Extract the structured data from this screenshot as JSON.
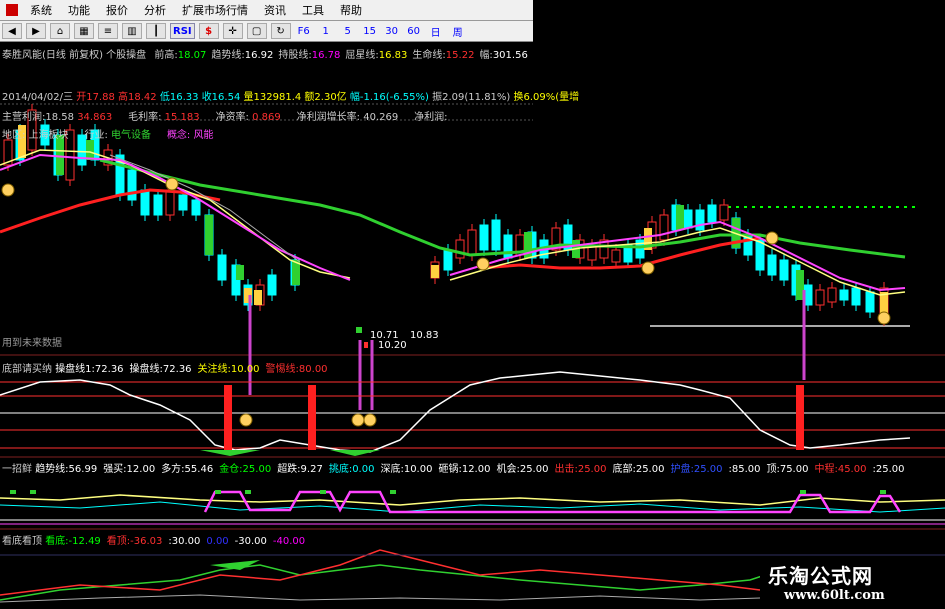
{
  "menu": [
    "系统",
    "功能",
    "报价",
    "分析",
    "扩展市场行情",
    "资讯",
    "工具",
    "帮助"
  ],
  "toolbar": [
    "F6",
    "1",
    "5",
    "15",
    "30",
    "60",
    "日",
    "周"
  ],
  "info_bar": {
    "title": "泰胜风能(日线 前复权) 个股操盘",
    "items": [
      {
        "label": "前高:",
        "value": "18.07",
        "color": "#00ff00"
      },
      {
        "label": "趋势线:",
        "value": "16.92",
        "color": "#ffffff"
      },
      {
        "label": "持股线:",
        "value": "16.78",
        "color": "#ff00ff"
      },
      {
        "label": "屈星线:",
        "value": "16.83",
        "color": "#ffff00"
      },
      {
        "label": "生命线:",
        "value": "15.22",
        "color": "#ff3030"
      },
      {
        "label": "幅:",
        "value": "301.56",
        "color": "#ffffff"
      }
    ]
  },
  "quote_bar": {
    "date": "2014/04/02/三",
    "open": "开17.88",
    "high": "高18.42",
    "low": "低16.33",
    "close": "收16.54",
    "vol": "量132981.4",
    "amt": "额2.30亿",
    "chg": "幅-1.16(-6.55%)",
    "amp": "振2.09(11.81%)",
    "turn": "换6.09%(量增"
  },
  "fund_bar": {
    "main": "主营利润:18.58",
    "main_v": "34.863",
    "profit": "毛利率:",
    "profit_v": "15.183",
    "net": "净资率:",
    "net_v": "0.869",
    "grow": "净利润增长率:",
    "grow_v": "40.269",
    "np": "净利润:"
  },
  "region_bar": {
    "region": "地区:",
    "region_v": "上海板块",
    "industry": "行业:",
    "industry_v": "电气设备",
    "concept": "概念:",
    "concept_v": "风能"
  },
  "future_label": "用到未来数据",
  "price_marks": {
    "a": "10.71",
    "b": "10.83",
    "c": "10.20"
  },
  "panel2": {
    "title": "底部请买纳",
    "items": [
      {
        "label": "操盘线1:",
        "value": "72.36",
        "color": "#ffffff"
      },
      {
        "label": "操盘线:",
        "value": "72.36",
        "color": "#ffffff"
      },
      {
        "label": "关注线:",
        "value": "10.00",
        "color": "#ffff00"
      },
      {
        "label": "警惕线:",
        "value": "80.00",
        "color": "#ff3030"
      },
      {
        "label": "",
        "value": "",
        "color": "#3030ff"
      }
    ]
  },
  "panel3": {
    "title": "一招鲜",
    "items": [
      {
        "label": "趋势线:",
        "value": "56.99",
        "color": "#ffffff"
      },
      {
        "label": "强买:",
        "value": "12.00",
        "color": "#ffffff"
      },
      {
        "label": "多方:",
        "value": "55.46",
        "color": "#ffffff"
      },
      {
        "label": "金仓:",
        "value": "25.00",
        "color": "#00ff00"
      },
      {
        "label": "超跌:",
        "value": "9.27",
        "color": "#ffffff"
      },
      {
        "label": "挑底:",
        "value": "0.00",
        "color": "#00ffff"
      },
      {
        "label": "深底:",
        "value": "10.00",
        "color": "#ffffff"
      },
      {
        "label": "砸锅:",
        "value": "12.00",
        "color": "#ffffff"
      },
      {
        "label": "机会:",
        "value": "25.00",
        "color": "#ffffff"
      },
      {
        "label": "出击:",
        "value": "25.00",
        "color": "#ff3030"
      },
      {
        "label": "底部:",
        "value": "25.00",
        "color": "#ffffff"
      },
      {
        "label": "护盘:",
        "value": "25.00",
        "color": "#3050ff"
      },
      {
        "label": ":",
        "value": "85.00",
        "color": "#ffffff"
      },
      {
        "label": "顶:",
        "value": "75.00",
        "color": "#ffffff"
      },
      {
        "label": "中程:",
        "value": "45.00",
        "color": "#ff3030"
      },
      {
        "label": ":",
        "value": "25.00",
        "color": "#ffffff"
      }
    ]
  },
  "panel4": {
    "title": "看底看顶",
    "items": [
      {
        "label": "看底:",
        "value": "-12.49",
        "color": "#00ff00"
      },
      {
        "label": "看顶:",
        "value": "-36.03",
        "color": "#ff3030"
      },
      {
        "label": ":",
        "value": "30.00",
        "color": "#ffffff"
      },
      {
        "label": "",
        "value": "0.00",
        "color": "#3030ff"
      },
      {
        "label": "",
        "value": "-30.00",
        "color": "#ffffff"
      },
      {
        "label": "",
        "value": "-40.00",
        "color": "#ff00ff"
      }
    ]
  },
  "watermark": {
    "title": "乐淘公式网",
    "url": "www.60lt.com"
  },
  "colors": {
    "up": "#ff3030",
    "down": "#00ffff",
    "green": "#30d030",
    "magenta": "#ff44ff",
    "yellow": "#ffff80"
  }
}
